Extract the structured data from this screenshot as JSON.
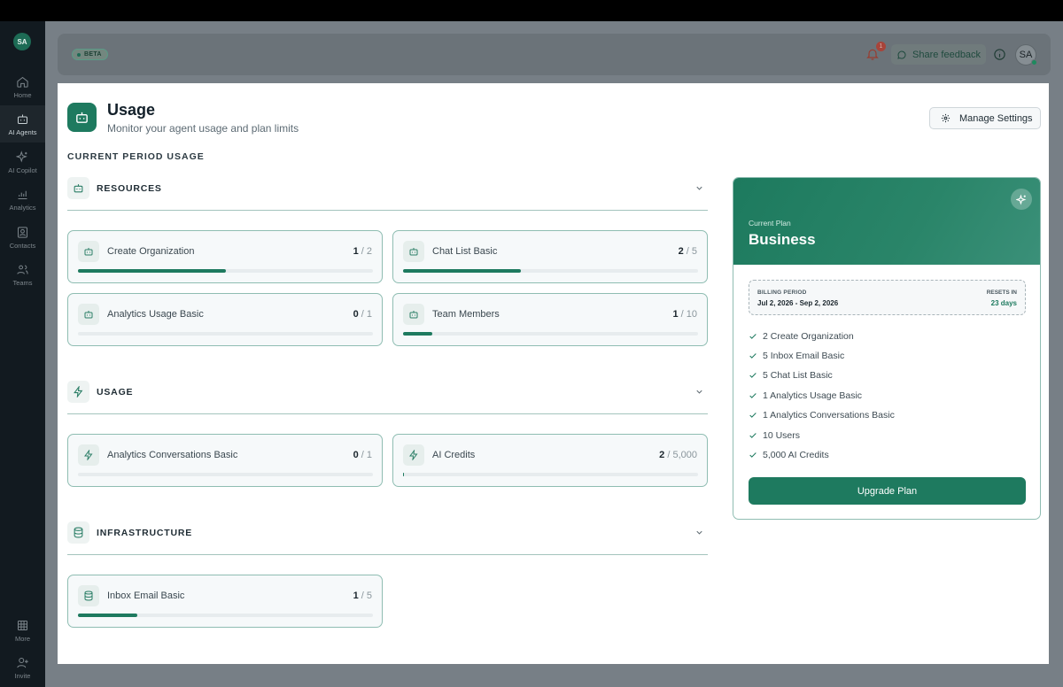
{
  "sidebar": {
    "avatar": "SA",
    "items": [
      {
        "label": "Home",
        "icon": "home-icon"
      },
      {
        "label": "AI Agents",
        "icon": "bot-icon"
      },
      {
        "label": "AI Copilot",
        "icon": "sparkles-icon"
      },
      {
        "label": "Analytics",
        "icon": "chart-icon"
      },
      {
        "label": "Contacts",
        "icon": "contact-icon"
      },
      {
        "label": "Teams",
        "icon": "users-icon"
      },
      {
        "label": "More",
        "icon": "grid-icon"
      },
      {
        "label": "Invite",
        "icon": "user-plus-icon"
      }
    ]
  },
  "header": {
    "badge": "BETA",
    "notification_count": "1",
    "feedback_label": "Share feedback",
    "avatar": "SA"
  },
  "page": {
    "title": "Usage",
    "subtitle": "Monitor your agent usage and plan limits",
    "manage_label": "Manage Settings",
    "period_heading": "CURRENT PERIOD USAGE"
  },
  "sections": {
    "resources": {
      "title": "RESOURCES",
      "cards": [
        {
          "label": "Create Organization",
          "used": "1",
          "limit": "/ 2",
          "progress": 0.5
        },
        {
          "label": "Chat List Basic",
          "used": "2",
          "limit": "/ 5",
          "progress": 0.4
        },
        {
          "label": "Analytics Usage Basic",
          "used": "0",
          "limit": "/ 1",
          "progress": 0
        },
        {
          "label": "Team Members",
          "used": "1",
          "limit": "/ 10",
          "progress": 0.1
        }
      ]
    },
    "usage": {
      "title": "USAGE",
      "cards": [
        {
          "label": "Analytics Conversations Basic",
          "used": "0",
          "limit": "/ 1",
          "progress": 0
        },
        {
          "label": "AI Credits",
          "used": "2",
          "limit": "/ 5,000",
          "progress": 0.0004
        }
      ]
    },
    "infrastructure": {
      "title": "INFRASTRUCTURE",
      "cards": [
        {
          "label": "Inbox Email Basic",
          "used": "1",
          "limit": "/ 5",
          "progress": 0.2
        }
      ]
    }
  },
  "plan": {
    "current_label": "Current Plan",
    "name": "Business",
    "billing_label": "BILLING PERIOD",
    "billing_value": "Jul 2, 2026 - Sep 2, 2026",
    "resets_label": "RESETS IN",
    "resets_value": "23 days",
    "features": [
      "2 Create Organization",
      "5 Inbox Email Basic",
      "5 Chat List Basic",
      "1 Analytics Usage Basic",
      "1 Analytics Conversations Basic",
      "10 Users",
      "5,000 AI Credits"
    ],
    "upgrade_label": "Upgrade Plan"
  },
  "colors": {
    "accent": "#1e7a5f",
    "sidebar": "#121a20"
  }
}
